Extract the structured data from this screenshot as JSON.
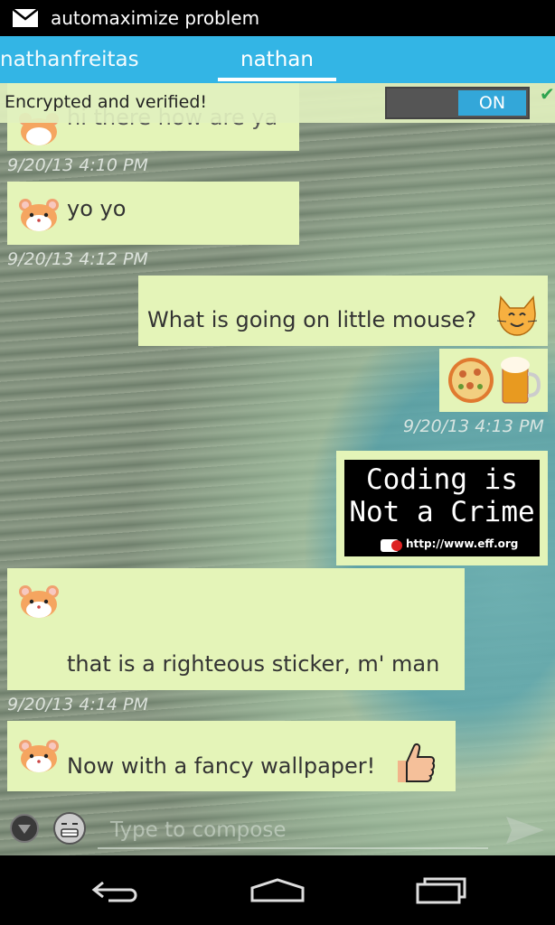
{
  "status_bar": {
    "title": "automaximize problem",
    "icon": "mail-icon"
  },
  "tabs": [
    {
      "label": "nathanfreitas"
    },
    {
      "label": "nathan"
    }
  ],
  "encryption": {
    "label": "Encrypted and verified!",
    "toggle_label": "ON",
    "verified_mark": "✔"
  },
  "messages": [
    {
      "partial_text": "hi there how are ya",
      "sender": "contact"
    },
    {
      "timestamp": "9/20/13 4:10 PM"
    },
    {
      "text": "yo yo",
      "sender": "contact"
    },
    {
      "timestamp": "9/20/13 4:12 PM"
    },
    {
      "text": "What is going on little mouse?",
      "sender": "me"
    },
    {
      "sender": "me",
      "emoji": [
        "pizza",
        "beer"
      ]
    },
    {
      "timestamp": "9/20/13 4:13 PM"
    },
    {
      "sticker": {
        "line1": "Coding is",
        "line2": "Not a Crime",
        "url": "http://www.eff.org"
      },
      "sender": "me"
    },
    {
      "text": "that is a righteous sticker, m' man",
      "sender": "contact"
    },
    {
      "timestamp": "9/20/13 4:14 PM"
    },
    {
      "text": "Now with a fancy wallpaper!",
      "sender": "contact"
    }
  ],
  "composer": {
    "placeholder": "Type to compose"
  }
}
